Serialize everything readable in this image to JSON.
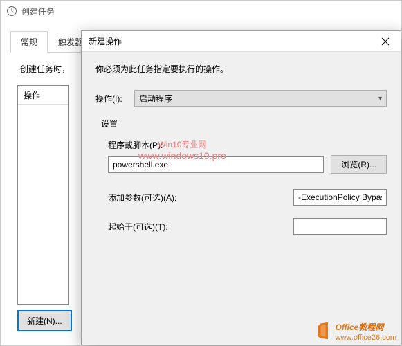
{
  "bg_window": {
    "title": "创建任务",
    "tabs": [
      "常规",
      "触发器"
    ],
    "desc_prefix": "创建任务时，",
    "action_col": "操作",
    "new_button": "新建(N)..."
  },
  "dialog": {
    "title": "新建操作",
    "instruction": "你必须为此任务指定要执行的操作。",
    "action_label": "操作(I):",
    "action_value": "启动程序",
    "settings_label": "设置",
    "program_label": "程序或脚本(P):",
    "program_value": "powershell.exe",
    "browse_label": "浏览(R)...",
    "args_label": "添加参数(可选)(A):",
    "args_value": "-ExecutionPolicy Bypas",
    "startin_label": "起始于(可选)(T):",
    "startin_value": ""
  },
  "watermark1": {
    "line1": "Win10专业网",
    "line2": "www.windows10.pro"
  },
  "watermark2": {
    "line1_a": "Office",
    "line1_b": "教程网",
    "line2": "www.office26.com"
  }
}
